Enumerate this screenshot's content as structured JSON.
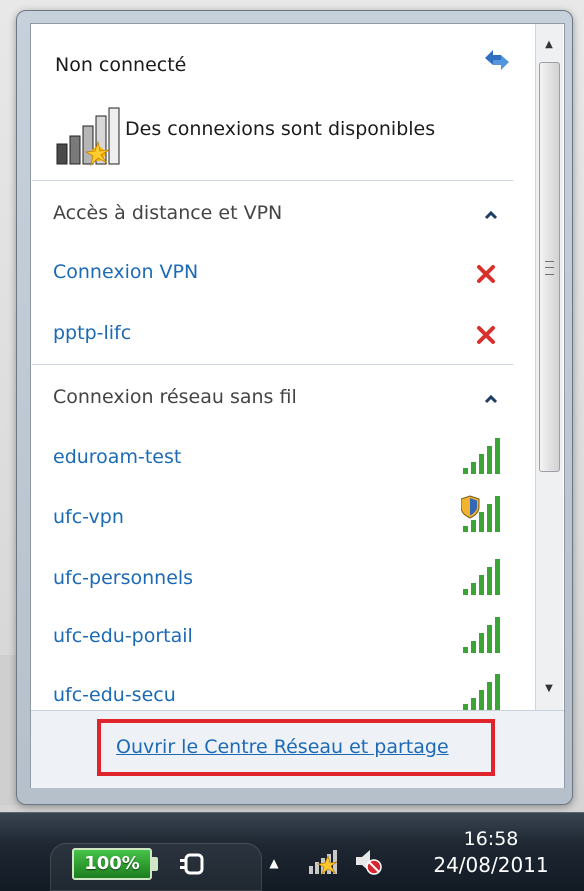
{
  "popup": {
    "status_title": "Non connecté",
    "available_text": "Des connexions sont disponibles",
    "refresh_icon": "refresh-arrows-icon"
  },
  "sections": [
    {
      "title": "Accès à distance et VPN",
      "items": [
        {
          "label": "Connexion VPN",
          "status_icon": "disconnect-x-icon",
          "status_color": "#d9302c"
        },
        {
          "label": "pptp-lifc",
          "status_icon": "disconnect-x-icon",
          "status_color": "#d9302c"
        }
      ]
    },
    {
      "title": "Connexion réseau sans fil",
      "items": [
        {
          "label": "eduroam-test",
          "status_icon": "wifi-signal-icon"
        },
        {
          "label": "ufc-vpn",
          "status_icon": "wifi-signal-shield-icon"
        },
        {
          "label": "ufc-personnels",
          "status_icon": "wifi-signal-icon"
        },
        {
          "label": "ufc-edu-portail",
          "status_icon": "wifi-signal-icon"
        },
        {
          "label": "ufc-edu-secu",
          "status_icon": "wifi-signal-icon"
        }
      ]
    }
  ],
  "footer": {
    "link_text": "Ouvrir le Centre Réseau et partage",
    "highlight_color": "#e0242c"
  },
  "taskbar": {
    "battery_percent": "100%",
    "time": "16:58",
    "date": "24/08/2011"
  },
  "colors": {
    "link_blue": "#1c6ab6",
    "signal_green": "#3aa535"
  }
}
